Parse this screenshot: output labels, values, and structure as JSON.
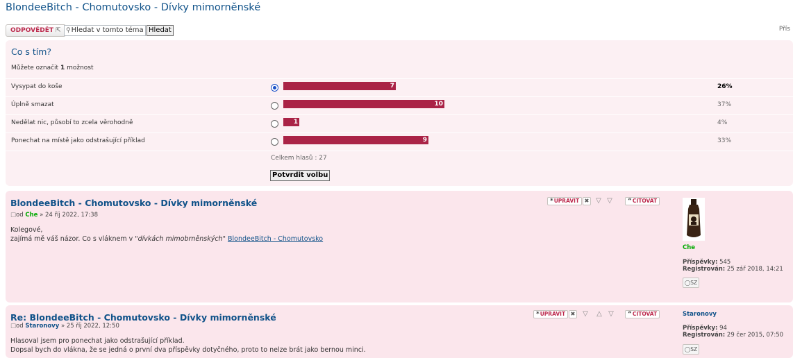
{
  "topic": {
    "title": "BlondeeBitch - Chomutovsko - Dívky mimorněnské"
  },
  "toolbar": {
    "reply_label": "ODPOVĚDĚT",
    "reply_arrow": "⇱",
    "search_placeholder": "Hledat v tomto téma",
    "search_button": "Hledat",
    "right_text": "Přís"
  },
  "poll": {
    "question": "Co s tím?",
    "hint_prefix": "Můžete označit",
    "hint_count": "1",
    "hint_suffix": "možnost",
    "total_votes": 27,
    "options": [
      {
        "label": "Vysypat do koše",
        "votes": 7,
        "percent": "26%",
        "selected": true,
        "lead": true
      },
      {
        "label": "Úplně smazat",
        "votes": 10,
        "percent": "37%",
        "selected": false,
        "lead": false
      },
      {
        "label": "Nedělat nic, působí to zcela věrohodně",
        "votes": 1,
        "percent": "4%",
        "selected": false,
        "lead": false
      },
      {
        "label": "Ponechat na místě jako odstrašující příklad",
        "votes": 9,
        "percent": "33%",
        "selected": false,
        "lead": false
      }
    ],
    "total_text": "Celkem hlasů : 27",
    "submit_label": "Potvrdit volbu"
  },
  "posts": [
    {
      "title": "BlondeeBitch - Chomutovsko - Dívky mimorněnské",
      "by": "od",
      "author": "Che",
      "author_color": "#00AA00",
      "date": "» 24 říj 2022, 17:38",
      "body_line1": "Kolegové,",
      "body_line2_pre": "zajímá mě váš názor. Co s vláknem v ",
      "body_line2_quote": "\"dívkách mimobrněnských\"",
      "body_line2_link": "BlondeeBitch - Chomutovsko",
      "tools": {
        "edit": "UPRAVIT",
        "quote": "CITOVAT"
      },
      "profile": {
        "name": "Che",
        "posts_label": "Příspěvky:",
        "posts": "545",
        "reg_label": "Registrován:",
        "reg": "25 zář 2018, 14:21",
        "pm": "SZ"
      }
    },
    {
      "title": "Re: BlondeeBitch - Chomutovsko - Dívky mimorněnské",
      "by": "od",
      "author": "Staronovy",
      "author_color": "#105289",
      "date": "» 25 říj 2022, 12:50",
      "body_line1": "Hlasoval jsem pro ponechat jako odstrašující příklad.",
      "body_line2": "Dopsal bych do vlákna, že se jedná o první dva příspěvky dotyčného, proto to nelze brát jako bernou minci.",
      "tools": {
        "edit": "UPRAVIT",
        "quote": "CITOVAT"
      },
      "profile": {
        "name": "Staronovy",
        "posts_label": "Příspěvky:",
        "posts": "94",
        "reg_label": "Registrován:",
        "reg": "29 čer 2015, 07:50",
        "pm": "SZ"
      }
    }
  ],
  "colors": {
    "title_blue": "#105289",
    "accent_red": "#BC2A4D",
    "poll_bar": "#AA2346",
    "post_bg": "#FBE6EC"
  }
}
